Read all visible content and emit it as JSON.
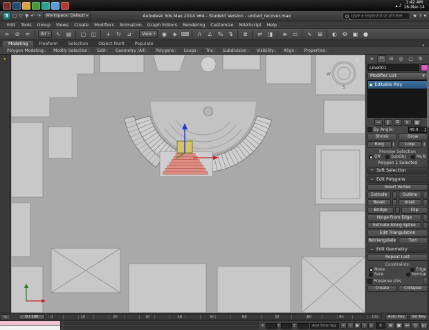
{
  "taskbar": {
    "clock_time": "1:42 AM",
    "clock_date": "16-Mar-14",
    "app_icons": [
      {
        "name": "taskbar-app-icon-1",
        "color": "#7a2f2f"
      },
      {
        "name": "taskbar-app-icon-2",
        "color": "#1f4e79"
      },
      {
        "name": "taskbar-app-icon-3",
        "color": "#d9a33c"
      },
      {
        "name": "taskbar-app-icon-4",
        "color": "#3f9c35"
      },
      {
        "name": "taskbar-app-icon-5",
        "color": "#2aa198"
      },
      {
        "name": "taskbar-app-icon-6",
        "color": "#5b9bd5"
      },
      {
        "name": "taskbar-app-icon-7",
        "color": "#b03a2e"
      }
    ],
    "tray_icons": [
      {
        "name": "tray-expand-icon",
        "glyph": "▴"
      },
      {
        "name": "tray-volume-icon",
        "glyph": "♪"
      }
    ]
  },
  "titlebar": {
    "logo_glyph": "3",
    "qat_icons": [
      {
        "name": "new-scene-icon",
        "glyph": "▢"
      },
      {
        "name": "open-file-icon",
        "glyph": "▽"
      },
      {
        "name": "save-file-icon",
        "glyph": "▼"
      },
      {
        "name": "undo-icon",
        "glyph": "↶"
      },
      {
        "name": "redo-icon",
        "glyph": "↷"
      }
    ],
    "workspace_label": "Workspace: Default",
    "title": "Autodesk 3ds Max 2014 x64 - Student Version - united_recover.max",
    "search_placeholder": "Type a keyword or phrase",
    "right_icons": [
      {
        "name": "favorites-star-icon",
        "glyph": "★"
      },
      {
        "name": "help-icon",
        "glyph": "?"
      },
      {
        "name": "infocenter-menu-icon",
        "glyph": "▾"
      }
    ]
  },
  "menus": [
    "Edit",
    "Tools",
    "Group",
    "Views",
    "Create",
    "Modifiers",
    "Animation",
    "Graph Editors",
    "Rendering",
    "Customize",
    "MAXScript",
    "Help"
  ],
  "toolbar": {
    "selection_filter": "All",
    "coord_system": "View",
    "icons_a": [
      {
        "name": "select-and-link-icon",
        "glyph": "∞"
      },
      {
        "name": "unlink-selection-icon",
        "glyph": "⊘"
      },
      {
        "name": "bind-to-space-warp-icon",
        "glyph": "≈"
      },
      {
        "sep": true
      }
    ],
    "icons_b": [
      {
        "name": "select-object-icon",
        "glyph": "↖"
      },
      {
        "name": "select-by-name-icon",
        "glyph": "▤"
      },
      {
        "sep": true
      },
      {
        "name": "rectangular-selection-region-icon",
        "glyph": "▢"
      },
      {
        "name": "window-crossing-icon",
        "glyph": "◫"
      },
      {
        "sep": true
      },
      {
        "name": "select-and-move-icon",
        "glyph": "+"
      },
      {
        "name": "select-and-rotate-icon",
        "glyph": "↻"
      },
      {
        "name": "select-and-scale-icon",
        "glyph": "⊿"
      },
      {
        "sep": true
      }
    ],
    "icons_c": [
      {
        "name": "use-pivot-center-icon",
        "glyph": "◉"
      },
      {
        "name": "select-and-manipulate-icon",
        "glyph": "◈"
      },
      {
        "name": "keyboard-shortcut-override-icon",
        "glyph": "⌨"
      },
      {
        "sep": true
      },
      {
        "name": "snaps-toggle-icon",
        "glyph": "∩"
      },
      {
        "name": "angle-snap-icon",
        "glyph": "∠"
      },
      {
        "name": "percent-snap-icon",
        "glyph": "%"
      },
      {
        "name": "spinner-snap-icon",
        "glyph": "⇅"
      },
      {
        "sep": true
      },
      {
        "name": "named-selection-sets-icon",
        "glyph": "≣"
      },
      {
        "sep": true
      },
      {
        "name": "mirror-icon",
        "glyph": "⇌"
      },
      {
        "name": "align-icon",
        "glyph": "◨"
      },
      {
        "sep": true
      },
      {
        "name": "scene-explorer-icon",
        "glyph": "≡"
      },
      {
        "name": "ribbon-toggle-icon",
        "glyph": "▭"
      },
      {
        "sep": true
      },
      {
        "name": "curve-editor-icon",
        "glyph": "∿"
      },
      {
        "name": "schematic-view-icon",
        "glyph": "⊞"
      },
      {
        "sep": true
      },
      {
        "name": "material-editor-icon",
        "glyph": "◐"
      },
      {
        "name": "render-setup-icon",
        "glyph": "⚙"
      },
      {
        "name": "rendered-frame-icon",
        "glyph": "▣"
      },
      {
        "name": "render-production-icon",
        "glyph": "●"
      }
    ]
  },
  "ribbon": {
    "tabs": [
      {
        "label": "Modeling",
        "active": true
      },
      {
        "label": "Freeform"
      },
      {
        "label": "Selection"
      },
      {
        "label": "Object Paint"
      },
      {
        "label": "Populate"
      }
    ],
    "minimize_glyph": "▴",
    "panels": [
      "Polygon Modeling",
      "Modify Selection",
      "Edit",
      "Geometry (All)",
      "Polygons",
      "Loops",
      "Tris",
      "Subdivision",
      "Visibility",
      "Align",
      "Properties"
    ]
  },
  "viewport": {
    "layout_tab_glyph": "▸",
    "viewcube": {
      "south": "S",
      "west": "W",
      "home_glyph": "⌂"
    }
  },
  "command_panel": {
    "tabs": [
      {
        "name": "create-tab-icon",
        "glyph": "∗"
      },
      {
        "name": "modify-tab-icon",
        "glyph": "◠",
        "active": true
      },
      {
        "name": "hierarchy-tab-icon",
        "glyph": "⊟"
      },
      {
        "name": "motion-tab-icon",
        "glyph": "◎"
      },
      {
        "name": "display-tab-icon",
        "glyph": "▢"
      },
      {
        "name": "utilities-tab-icon",
        "glyph": "⚙"
      }
    ],
    "object_name": "Line001",
    "swatch_style": "background:#e35cc8",
    "modifier_list_label": "Modifier List",
    "stack_item": "Editable Poly",
    "stack_item_icon": "●",
    "stack_tools": [
      {
        "name": "pin-stack-icon",
        "glyph": "⊸"
      },
      {
        "name": "show-end-result-icon",
        "glyph": "‖"
      },
      {
        "name": "make-unique-icon",
        "glyph": "⧉"
      },
      {
        "name": "remove-modifier-icon",
        "glyph": "✕"
      },
      {
        "name": "configure-modifier-sets-icon",
        "glyph": "▦"
      }
    ],
    "selection": {
      "by_angle_label": "By Angle:",
      "by_angle_value": "45.0",
      "shrink": "Shrink",
      "grow": "Grow",
      "ring": "Ring",
      "loop": "Loop",
      "preview_label": "Preview Selection",
      "preview_options": {
        "off": "Off",
        "subobj": "SubObj",
        "multi": "Multi"
      },
      "status_text": "Polygon 1 Selected"
    },
    "soft_selection": {
      "sign": "+",
      "label": "Soft Selection"
    },
    "edit_polygons": {
      "sign": "−",
      "label": "Edit Polygons",
      "insert_vertex": "Insert Vertex",
      "extrude": "Extrude",
      "outline": "Outline",
      "bevel": "Bevel",
      "inset": "Inset",
      "bridge": "Bridge",
      "flip": "Flip",
      "hinge_from_edge": "Hinge From Edge",
      "extrude_along_spline": "Extrude Along Spline",
      "edit_triangulation": "Edit Triangulation",
      "retriangulate": "Retriangulate",
      "turn": "Turn"
    },
    "edit_geometry": {
      "sign": "−",
      "label": "Edit Geometry",
      "repeat_last": "Repeat Last",
      "constraints_label": "Constraints:",
      "constraints": {
        "none": "None",
        "edge": "Edge",
        "face": "Face",
        "normal": "Normal"
      },
      "preserve_uvs": "Preserve UVs",
      "create": "Create",
      "collapse": "Collapse"
    }
  },
  "timeline": {
    "curve_editor_glyph": "∿",
    "slider_label": "0 / 100",
    "ticks": [
      "0",
      "10",
      "20",
      "30",
      "40",
      "50",
      "60",
      "70",
      "80",
      "90",
      "100"
    ],
    "auto_key": "Auto Key",
    "set_key": "Set Key"
  },
  "statusbar": {
    "x_label": "X:",
    "y_label": "Y:",
    "z_label": "Z:",
    "add_time_tag": "Add Time Tag",
    "transport": [
      {
        "name": "go-to-start-icon",
        "glyph": "«"
      },
      {
        "name": "previous-frame-icon",
        "glyph": "‹"
      },
      {
        "name": "play-animation-icon",
        "glyph": "▶"
      },
      {
        "name": "next-frame-icon",
        "glyph": "›"
      },
      {
        "name": "go-to-end-icon",
        "glyph": "»"
      }
    ],
    "current_frame": "0",
    "nav_icons": [
      {
        "name": "zoom-icon",
        "glyph": "⊕"
      },
      {
        "name": "zoom-extents-icon",
        "glyph": "▣"
      },
      {
        "name": "pan-icon",
        "glyph": "↔"
      },
      {
        "name": "orbit-icon",
        "glyph": "↻"
      },
      {
        "name": "maximize-viewport-icon",
        "glyph": "◱"
      }
    ]
  }
}
